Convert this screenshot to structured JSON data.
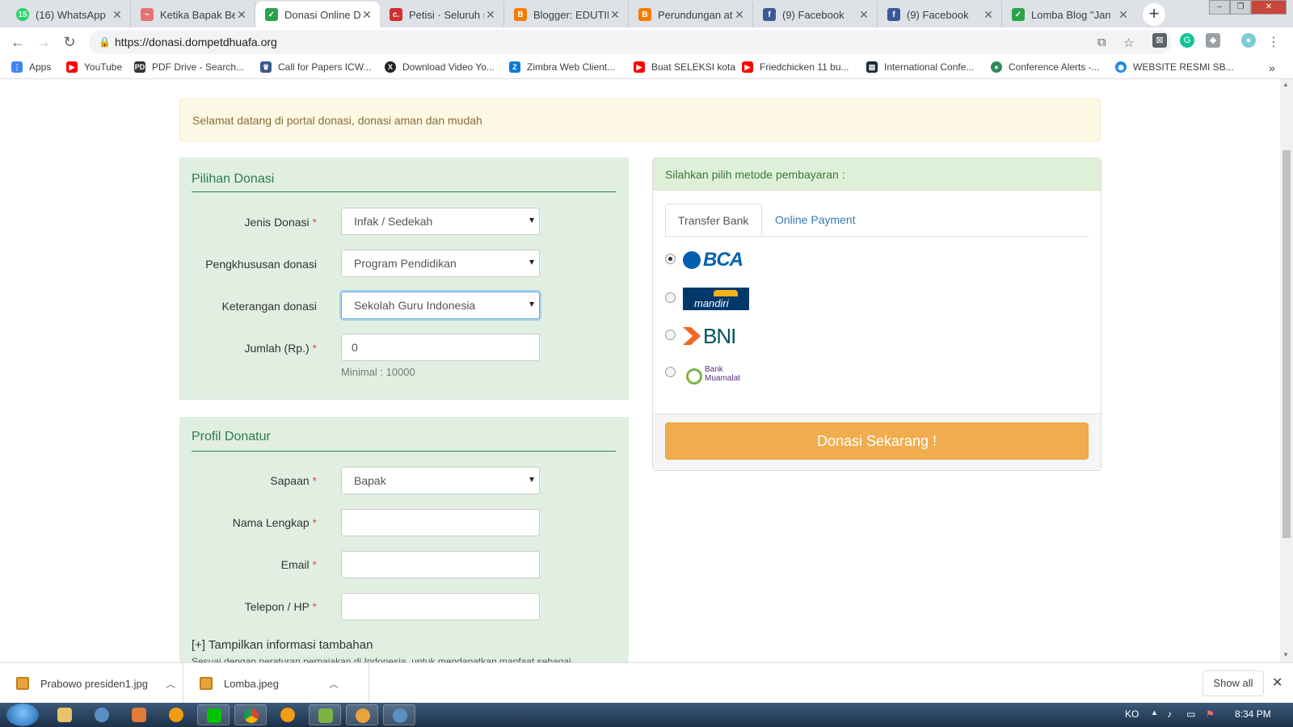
{
  "browser": {
    "tabs": [
      {
        "title": "(16) WhatsApp",
        "icon": "whatsapp-icon",
        "color": "#25d366",
        "glyph": "15"
      },
      {
        "title": "Ketika Bapak Berl",
        "icon": "site-icon",
        "color": "#e57373",
        "glyph": "~"
      },
      {
        "title": "Donasi Online Do",
        "icon": "dompet-dhuafa-icon",
        "color": "#2aa24a",
        "glyph": "✓"
      },
      {
        "title": "Petisi · Seluruh ra",
        "icon": "change-org-icon",
        "color": "#d32f2f",
        "glyph": "c."
      },
      {
        "title": "Blogger: EDUTIPS",
        "icon": "blogger-icon",
        "color": "#f57c00",
        "glyph": "B"
      },
      {
        "title": "Perundungan ata",
        "icon": "blogger-icon",
        "color": "#f57c00",
        "glyph": "B"
      },
      {
        "title": "(9) Facebook",
        "icon": "facebook-icon",
        "color": "#3b5998",
        "glyph": "f"
      },
      {
        "title": "(9) Facebook",
        "icon": "facebook-icon",
        "color": "#3b5998",
        "glyph": "f"
      },
      {
        "title": "Lomba Blog \"Jan",
        "icon": "dompet-dhuafa-icon",
        "color": "#2aa24a",
        "glyph": "✓"
      }
    ],
    "url": "https://donasi.dompetdhuafa.org",
    "bookmarks": [
      {
        "label": "Apps",
        "icon": "apps-grid-icon",
        "color": "#4285f4",
        "glyph": "⋮"
      },
      {
        "label": "YouTube",
        "icon": "youtube-icon",
        "color": "#ff0000",
        "glyph": "▶"
      },
      {
        "label": "PDF Drive - Search...",
        "icon": "pdf-drive-icon",
        "color": "#333333",
        "glyph": "PD"
      },
      {
        "label": "Call for Papers ICW...",
        "icon": "conference-icon",
        "color": "#3a5a8c",
        "glyph": "♛"
      },
      {
        "label": "Download Video Yo...",
        "icon": "download-site-icon",
        "color": "#222222",
        "glyph": "X"
      },
      {
        "label": "Zimbra Web Client...",
        "icon": "zimbra-icon",
        "color": "#0e7bd6",
        "glyph": "Z"
      },
      {
        "label": "Buat SELEKSI kota",
        "icon": "youtube-icon",
        "color": "#ff0000",
        "glyph": "▶"
      },
      {
        "label": "Friedchicken 11 bu...",
        "icon": "youtube-icon",
        "color": "#ff0000",
        "glyph": "▶"
      },
      {
        "label": "International Confe...",
        "icon": "site-icon",
        "color": "#1a2a3a",
        "glyph": "▤"
      },
      {
        "label": "Conference Alerts -...",
        "icon": "globe-icon",
        "color": "#2e8b57",
        "glyph": "●"
      },
      {
        "label": "WEBSITE RESMI SB...",
        "icon": "site-icon",
        "color": "#1e88e5",
        "glyph": "◉"
      }
    ]
  },
  "page": {
    "alert": "Selamat datang di portal donasi, donasi aman dan mudah",
    "donation": {
      "title": "Pilihan Donasi",
      "jenis_label": "Jenis Donasi",
      "jenis_value": "Infak / Sedekah",
      "pengkhususan_label": "Pengkhususan donasi",
      "pengkhususan_value": "Program Pendidikan",
      "keterangan_label": "Keterangan donasi",
      "keterangan_value": "Sekolah Guru Indonesia",
      "jumlah_label": "Jumlah (Rp.)",
      "jumlah_value": "0",
      "minimal": "Minimal : 10000",
      "required_mark": "*"
    },
    "profile": {
      "title": "Profil Donatur",
      "sapaan_label": "Sapaan",
      "sapaan_value": "Bapak",
      "nama_label": "Nama Lengkap",
      "email_label": "Email",
      "telepon_label": "Telepon / HP",
      "more_info": "[+] Tampilkan informasi tambahan",
      "cut_text": "Sesuai dengan peraturan perpajakan di Indonesia, untuk mendapatkan manfaat sebagai"
    },
    "payment": {
      "header": "Silahkan pilih metode pembayaran :",
      "tab_bank": "Transfer Bank",
      "tab_online": "Online Payment",
      "banks": [
        {
          "name": "BCA",
          "selected": true
        },
        {
          "name": "mandiri",
          "selected": false
        },
        {
          "name": "BNI",
          "selected": false
        },
        {
          "name": "Bank Muamalat",
          "selected": false
        }
      ],
      "submit": "Donasi Sekarang !"
    }
  },
  "downloads": {
    "items": [
      {
        "name": "Prabowo presiden1.jpg"
      },
      {
        "name": "Lomba.jpeg"
      }
    ],
    "show_all": "Show all"
  },
  "taskbar": {
    "lang": "KO",
    "time": "8:34 PM"
  },
  "colors": {
    "panel_green": "#e0efe2",
    "title_green": "#2e7d4a",
    "donate_orange": "#f0ad4e",
    "alert_bg": "#fcf8e3"
  }
}
